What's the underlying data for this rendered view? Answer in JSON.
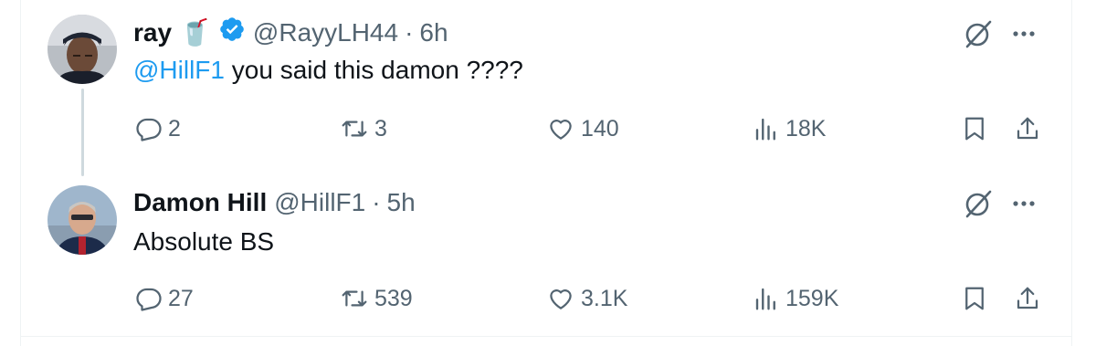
{
  "tweets": [
    {
      "name": "ray",
      "emoji": "🥤",
      "verified": true,
      "handle": "@RayyLH44",
      "separator": "·",
      "time": "6h",
      "mention": "@HillF1",
      "text": " you said this damon ????",
      "replies": "2",
      "reposts": "3",
      "likes": "140",
      "views": "18K"
    },
    {
      "name": "Damon Hill",
      "handle": "@HillF1",
      "separator": "·",
      "time": "5h",
      "text": "Absolute BS",
      "replies": "27",
      "reposts": "539",
      "likes": "3.1K",
      "views": "159K"
    }
  ],
  "icons": {
    "reply": "reply-icon",
    "repost": "repost-icon",
    "like": "like-icon",
    "views": "views-icon",
    "bookmark": "bookmark-icon",
    "share": "share-icon",
    "grok": "grok-icon",
    "more": "more-icon",
    "verified": "verified-badge-icon"
  },
  "colors": {
    "text": "#0f1419",
    "secondary": "#536471",
    "link": "#1d9bf0",
    "verified": "#1d9bf0",
    "thread_line": "#cfd9de",
    "border": "#eff3f4"
  }
}
